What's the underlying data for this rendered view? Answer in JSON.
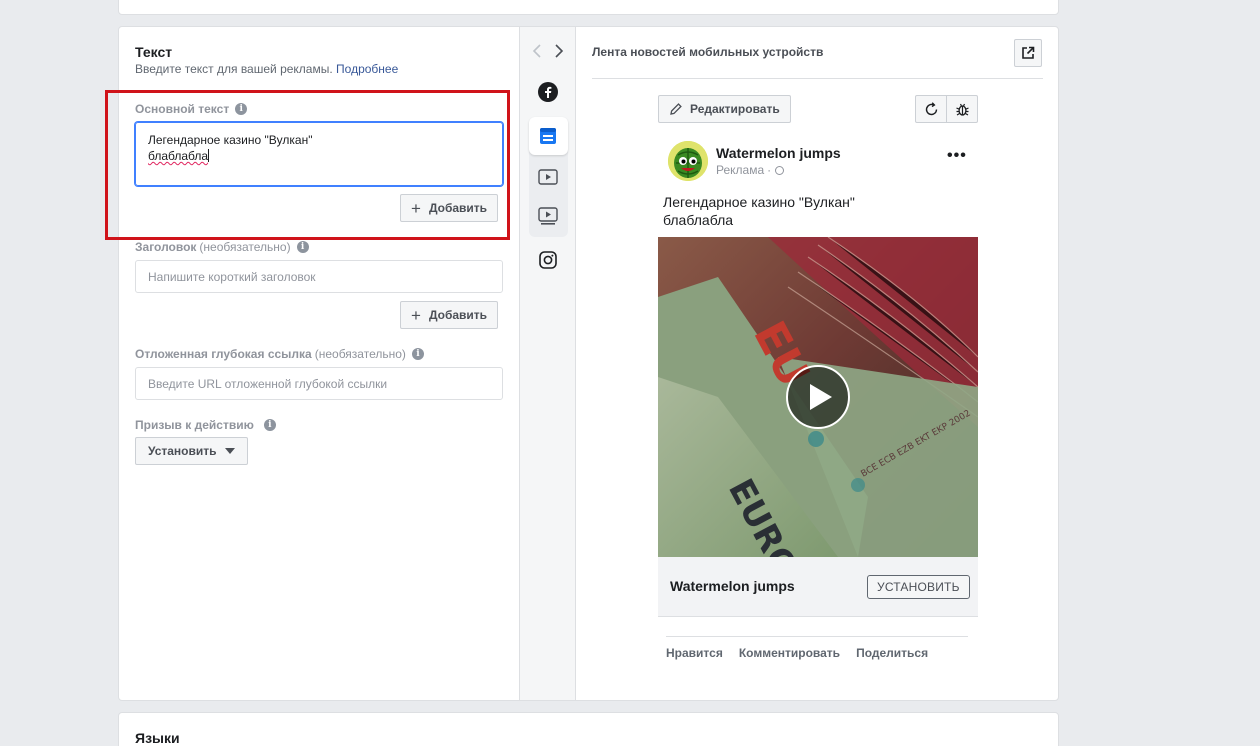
{
  "text_section": {
    "title": "Текст",
    "subtitle": "Введите текст для вашей рекламы.",
    "learn_more": "Подробнее"
  },
  "primary_text": {
    "label": "Основной текст",
    "line1": "Легендарное казино \"Вулкан\"",
    "line2": "блаблабла",
    "add_label": "Добавить"
  },
  "headline": {
    "label": "Заголовок",
    "optional": "(необязательно)",
    "placeholder": "Напишите короткий заголовок",
    "add_label": "Добавить"
  },
  "deep_link": {
    "label": "Отложенная глубокая ссылка",
    "optional": "(необязательно)",
    "placeholder": "Введите URL отложенной глубокой ссылки"
  },
  "cta": {
    "label": "Призыв к действию",
    "value": "Установить"
  },
  "preview": {
    "placement": "Лента новостей мобильных устройств",
    "edit_label": "Редактировать",
    "page_name": "Watermelon jumps",
    "sponsored": "Реклама",
    "post_line1": "Легендарное казино \"Вулкан\"",
    "post_line2": "блаблабла",
    "cta_name": "Watermelon jumps",
    "cta_button": "УСТАНОВИТЬ",
    "actions": [
      "Нравится",
      "Комментировать",
      "Поделиться"
    ]
  },
  "languages": {
    "title": "Языки"
  },
  "colors": {
    "accent": "#385898",
    "highlight": "#d0131a",
    "focus": "#4080ff"
  }
}
